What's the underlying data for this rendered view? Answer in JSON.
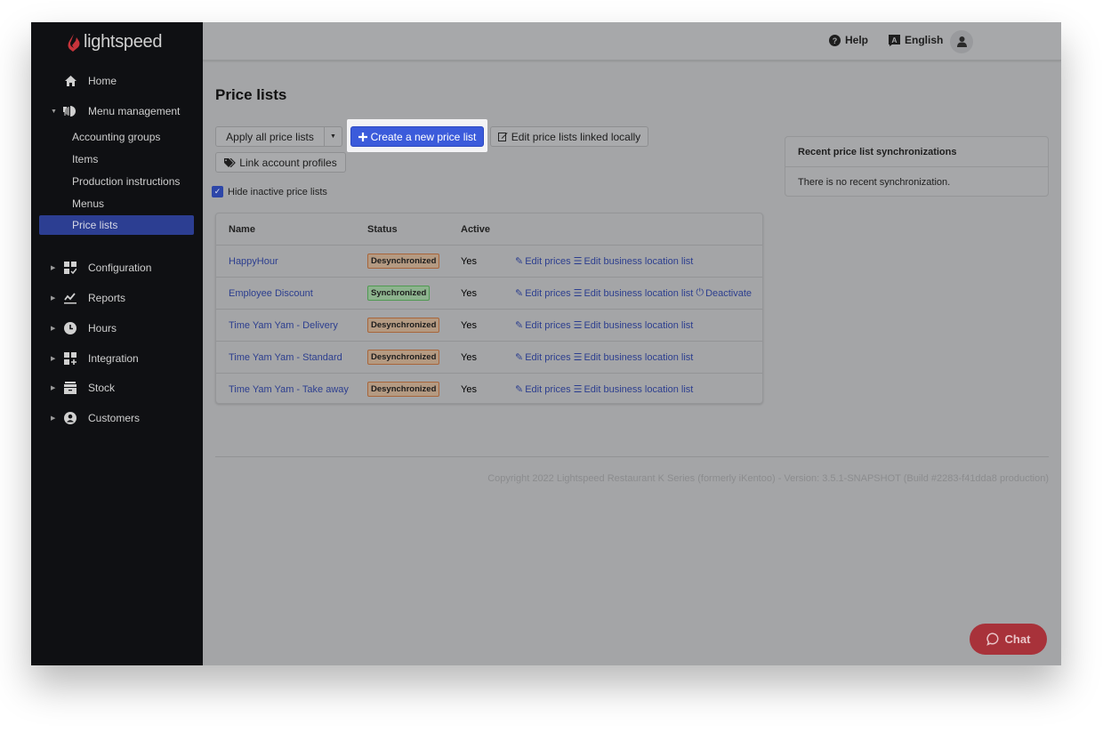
{
  "brand": {
    "name": "lightspeed",
    "logo_color": "#c7343b"
  },
  "sidebar": {
    "home": {
      "label": "Home",
      "icon": "home-icon"
    },
    "menu_management": {
      "label": "Menu management",
      "icon": "menu-management-icon",
      "expanded": true,
      "items": [
        {
          "label": "Accounting groups"
        },
        {
          "label": "Items"
        },
        {
          "label": "Production instructions"
        },
        {
          "label": "Menus"
        },
        {
          "label": "Price lists",
          "active": true
        }
      ]
    },
    "sections": [
      {
        "label": "Configuration",
        "icon": "configuration-icon"
      },
      {
        "label": "Reports",
        "icon": "reports-icon"
      },
      {
        "label": "Hours",
        "icon": "clock-icon"
      },
      {
        "label": "Integration",
        "icon": "integration-icon"
      },
      {
        "label": "Stock",
        "icon": "stock-icon"
      },
      {
        "label": "Customers",
        "icon": "customer-icon"
      }
    ],
    "active_color": "#2c3e92"
  },
  "header": {
    "help_label": "Help",
    "language_label": "English",
    "avatar_icon": "user-icon"
  },
  "main": {
    "title": "Price lists",
    "buttons": {
      "apply_all": "Apply all price lists",
      "create_new": "Create a new price list",
      "edit_linked_locally": "Edit price lists linked locally",
      "link_account_profiles": "Link account profiles"
    },
    "hide_inactive": {
      "label": "Hide inactive price lists",
      "checked": true
    },
    "table": {
      "columns": [
        "Name",
        "Status",
        "Active"
      ],
      "rows": [
        {
          "name": "HappyHour",
          "status": "Desynchronized",
          "active": "Yes",
          "actions": [
            "Edit prices",
            "Edit business location list"
          ]
        },
        {
          "name": "Employee Discount",
          "status": "Synchronized",
          "active": "Yes",
          "actions": [
            "Edit prices",
            "Edit business location list",
            "Deactivate"
          ]
        },
        {
          "name": "Time Yam Yam - Delivery",
          "status": "Desynchronized",
          "active": "Yes",
          "actions": [
            "Edit prices",
            "Edit business location list"
          ]
        },
        {
          "name": "Time Yam Yam - Standard",
          "status": "Desynchronized",
          "active": "Yes",
          "actions": [
            "Edit prices",
            "Edit business location list"
          ]
        },
        {
          "name": "Time Yam Yam - Take away",
          "status": "Desynchronized",
          "active": "Yes",
          "actions": [
            "Edit prices",
            "Edit business location list"
          ]
        }
      ]
    },
    "sync_panel": {
      "title": "Recent price list synchronizations",
      "empty_text": "There is no recent synchronization."
    },
    "footer": "Copyright 2022 Lightspeed Restaurant K Series (formerly iKentoo) - Version: 3.5.1-SNAPSHOT (Build #2283-f41dda8 production)"
  },
  "chat": {
    "label": "Chat",
    "color": "#a8323a"
  },
  "colors": {
    "primary": "#3b5bdb",
    "link": "#2c3e8f",
    "desync": "#a8653a",
    "sync": "#4f9a52"
  }
}
